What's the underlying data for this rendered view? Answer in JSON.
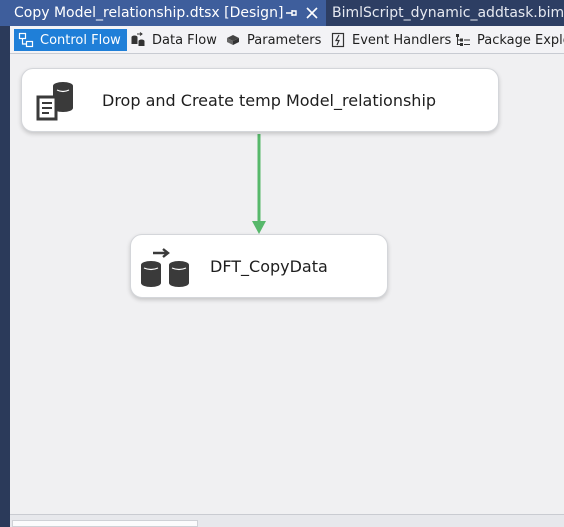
{
  "tabs": {
    "active": {
      "title": "Copy Model_relationship.dtsx [Design]",
      "pin_glyph": "⭾",
      "close_glyph": "✕"
    },
    "inactive": {
      "title": "BimlScript_dynamic_addtask.biml"
    }
  },
  "designer_tabs": [
    {
      "label": "Control Flow",
      "icon": "control-flow-icon",
      "selected": true
    },
    {
      "label": "Data Flow",
      "icon": "data-flow-icon",
      "selected": false
    },
    {
      "label": "Parameters",
      "icon": "parameters-icon",
      "selected": false
    },
    {
      "label": "Event Handlers",
      "icon": "event-handlers-icon",
      "selected": false
    },
    {
      "label": "Package Explo",
      "icon": "package-explorer-icon",
      "selected": false
    }
  ],
  "tasks": [
    {
      "label": "Drop and Create temp Model_relationship",
      "icon": "sql-task-icon"
    },
    {
      "label": "DFT_CopyData",
      "icon": "data-flow-task-icon"
    }
  ],
  "colors": {
    "connector": "#57b86b",
    "selected_tab": "#1f7fd8",
    "title_bar": "#2d3e63",
    "active_doc_tab": "#3e5e9c"
  }
}
